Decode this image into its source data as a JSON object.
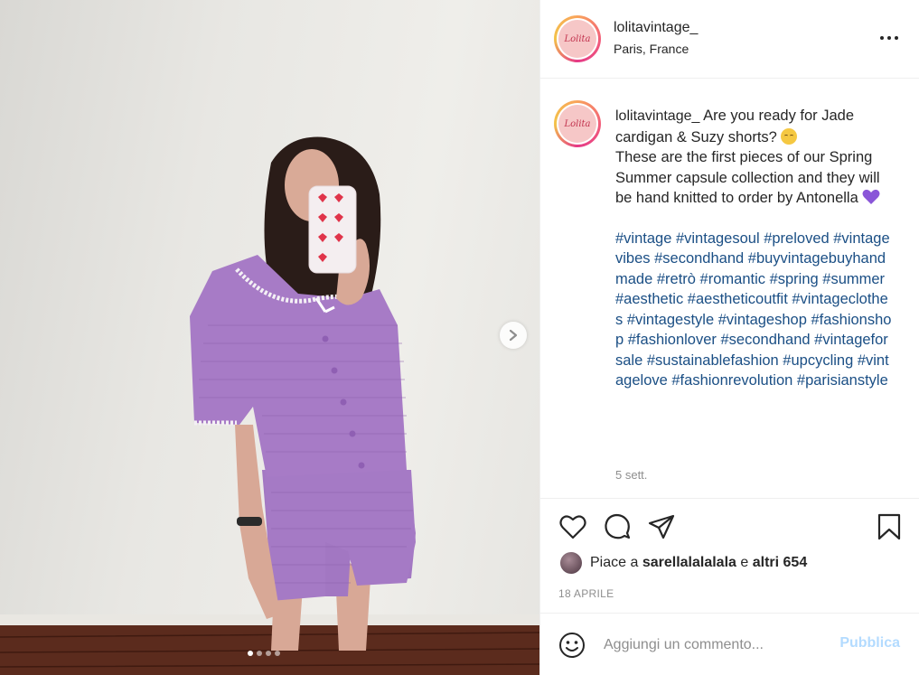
{
  "post": {
    "username": "lolitavintage_",
    "location": "Paris, France",
    "avatar_text": "Lolita",
    "caption_intro": "Are you ready for Jade cardigan & Suzy shorts?",
    "caption_body": "These are the first pieces of our Spring Summer capsule collection and they will be hand knitted to order by Antonella",
    "hashtags": "#vintage #vintagesoul #preloved #vintagevibes #secondhand #buyvintagebuyhandmade #retrò #romantic #spring #summer #aesthetic #aestheticoutfit #vintageclothes #vintagestyle #vintageshop #fashionshop #fashionlover #secondhand #vintageforsale #sustainablefashion #upcycling #vintagelove #fashionrevolution #parisianstyle",
    "time_ago": "5 sett.",
    "date": "18 APRILE"
  },
  "likes": {
    "prefix": "Piace a",
    "liker": "sarellalalalala",
    "conjunction": "e",
    "others": "altri 654"
  },
  "comment": {
    "placeholder": "Aggiungi un commento...",
    "publish_label": "Pubblica"
  },
  "carousel": {
    "slides": 4,
    "current": 1
  },
  "colors": {
    "hashtag": "#1b4f85",
    "publish_disabled": "#b3dbff",
    "muted": "#8e8e8e",
    "cardigan": "#a77bc6"
  },
  "icons": [
    "more-icon",
    "heart-icon",
    "comment-icon",
    "share-icon",
    "bookmark-icon",
    "emoji-icon",
    "chevron-right-icon"
  ]
}
